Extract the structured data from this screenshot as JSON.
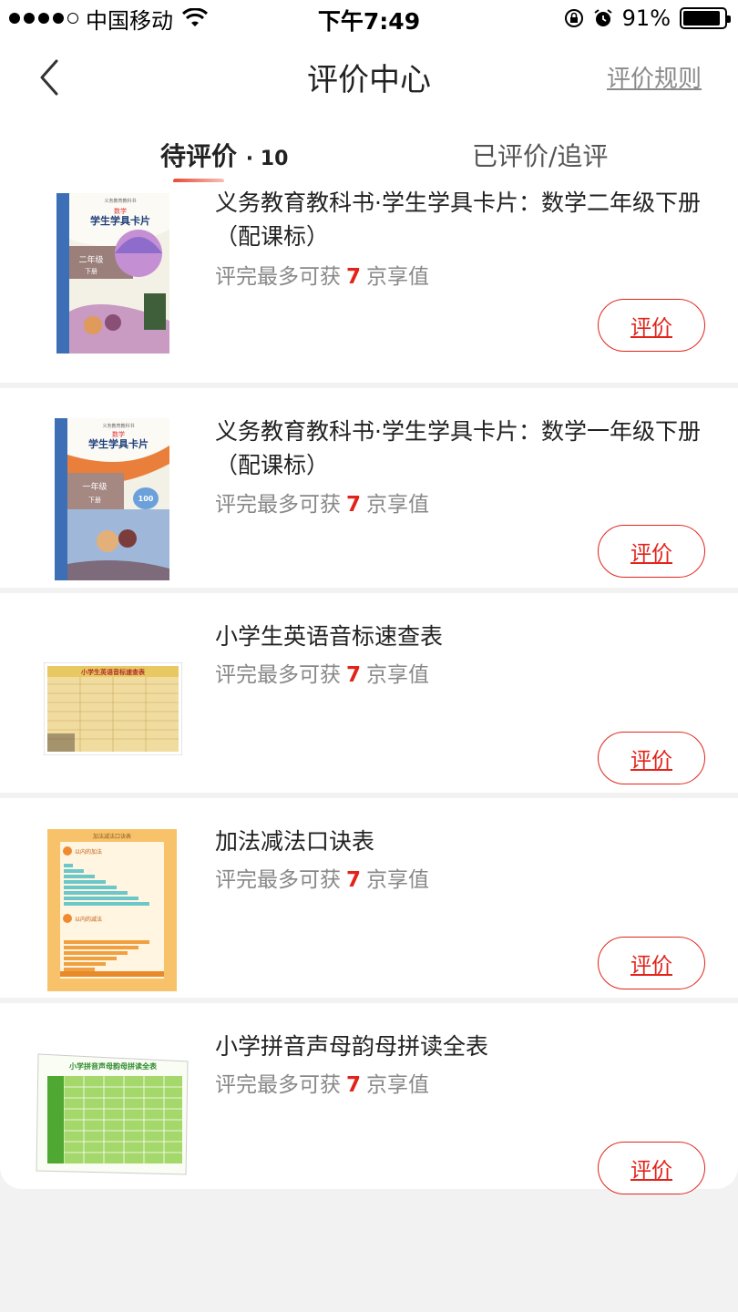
{
  "status_bar": {
    "carrier": "中国移动",
    "time": "下午7:49",
    "battery_percent": "91%",
    "battery_level": 0.91,
    "icons": [
      "signal-dots",
      "wifi-icon",
      "rotation-lock-icon",
      "alarm-icon",
      "battery-icon"
    ]
  },
  "nav": {
    "title": "评价中心",
    "rules_link": "评价规则",
    "back_icon": "chevron-left-icon"
  },
  "tabs": {
    "pending_label": "待评价",
    "pending_count": "· 10",
    "done_label": "已评价/追评",
    "accent": "#e84a3a"
  },
  "products": [
    {
      "title": "义务教育教科书·学生学具卡片：数学二年级下册（配课标）",
      "sub_prefix": "评完最多可获",
      "sub_value": "7",
      "sub_suffix": "京享值",
      "button": "评价",
      "thumb_main": "学生学具卡片",
      "thumb_top": "义务教育教科书",
      "thumb_subject": "数学",
      "thumb_grade": "二年级",
      "thumb_vol": "下册"
    },
    {
      "title": "义务教育教科书·学生学具卡片：数学一年级下册 （配课标）",
      "sub_prefix": "评完最多可获",
      "sub_value": "7",
      "sub_suffix": "京享值",
      "button": "评价",
      "thumb_main": "学生学具卡片",
      "thumb_top": "义务教育教科书",
      "thumb_subject": "数学",
      "thumb_grade": "一年级",
      "thumb_vol": "下册",
      "thumb_badge": "100"
    },
    {
      "title": "小学生英语音标速查表",
      "sub_prefix": "评完最多可获",
      "sub_value": "7",
      "sub_suffix": "京享值",
      "button": "评价",
      "thumb_main": "小学生英语音标速查表"
    },
    {
      "title": "加法减法口诀表",
      "sub_prefix": "评完最多可获",
      "sub_value": "7",
      "sub_suffix": "京享值",
      "button": "评价",
      "thumb_main": "加法减法口诀表",
      "thumb_add": "以内的加法",
      "thumb_sub": "以内的减法"
    },
    {
      "title": "小学拼音声母韵母拼读全表",
      "sub_prefix": "评完最多可获",
      "sub_value": "7",
      "sub_suffix": "京享值",
      "button": "评价",
      "thumb_main": "小学拼音声母韵母拼读全表"
    }
  ],
  "colors": {
    "accent_red": "#e2231a",
    "muted_text": "#888888",
    "background": "#f2f2f2"
  }
}
